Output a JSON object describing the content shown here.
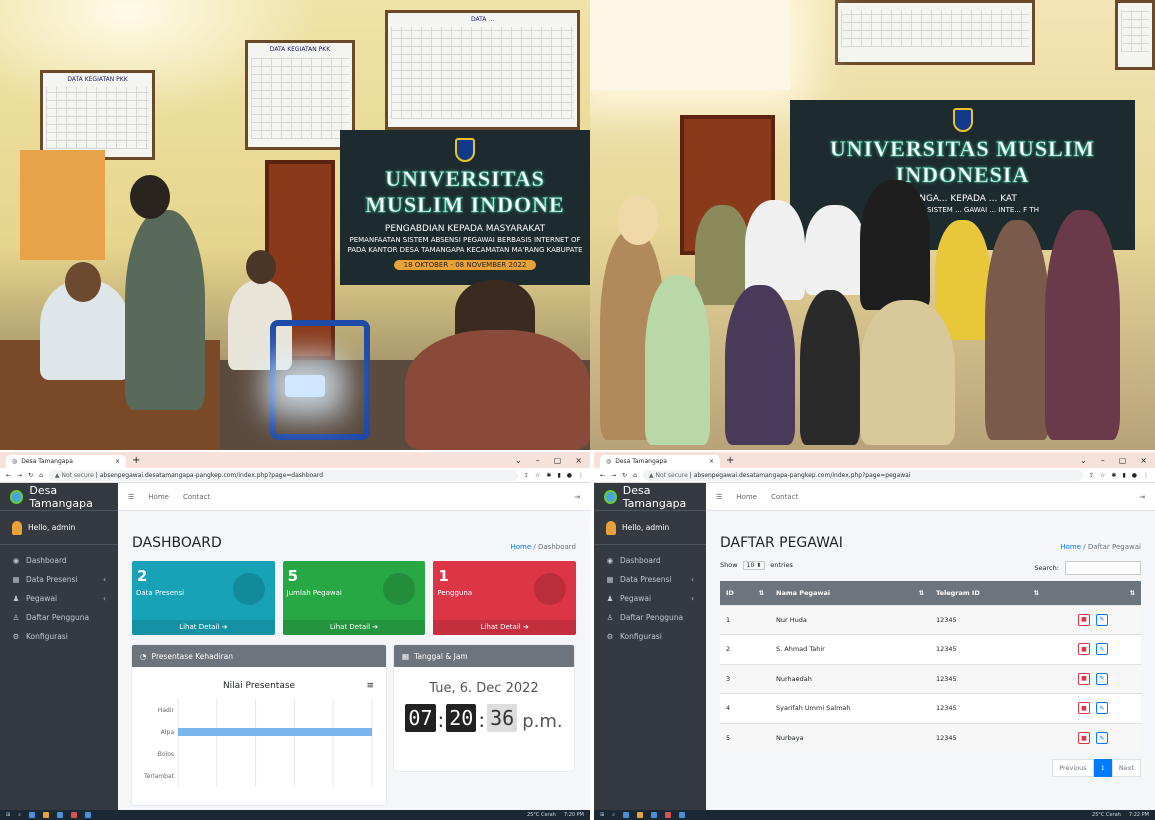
{
  "photos": {
    "left": {
      "banner": {
        "university": "UNIVERSITAS MUSLIM INDONE",
        "line1": "PENGABDIAN KEPADA MASYARAKAT",
        "line2": "PEMANFAATAN SISTEM ABSENSI PEGAWAI BERBASIS INTERNET OF",
        "line3": "PADA KANTOR DESA TAMANGAPA KECAMATAN MA'RANG KABUPATE",
        "date": "18 OKTOBER - 08 NOVEMBER 2022"
      },
      "board1": "DATA KEGIATAN PKK",
      "board2": "DATA KEGIATAN PKK",
      "board3": "DATA ..."
    },
    "right": {
      "banner": {
        "university": "UNIVERSITAS MUSLIM INDONESIA",
        "line1": "PENGA... KEPADA ... KAT",
        "line2": "PEMAN... N SISTEM ... GAWAI ... INTE... F TH"
      }
    }
  },
  "shot1": {
    "tab_title": "Desa Tamangapa",
    "url_security": "Not secure",
    "url": "absenpegawai.desatamangapa-pangkep.com/index.php?page=dashboard",
    "brand": "Desa Tamangapa",
    "user": "Hello, admin",
    "nav": [
      {
        "label": "Dashboard",
        "icon": "tachometer-icon",
        "glyph": "◉"
      },
      {
        "label": "Data Presensi",
        "icon": "calendar-icon",
        "glyph": "▦",
        "chev": "‹"
      },
      {
        "label": "Pegawai",
        "icon": "users-icon",
        "glyph": "♟",
        "chev": "‹"
      },
      {
        "label": "Daftar Pengguna",
        "icon": "user-group-icon",
        "glyph": "♙"
      },
      {
        "label": "Konfigurasi",
        "icon": "cogs-icon",
        "glyph": "⚙"
      }
    ],
    "topnav": {
      "menu": "☰",
      "home": "Home",
      "contact": "Contact",
      "logout": "⇥"
    },
    "page_title": "DASHBOARD",
    "crumb_home": "Home",
    "crumb_sep": "/",
    "crumb_current": "Dashboard",
    "boxes": [
      {
        "value": "2",
        "label": "Data Presensi",
        "link": "Lihat Detail ➔",
        "color": "#17a2b8",
        "icon": "pie-chart-icon"
      },
      {
        "value": "5",
        "label": "Jumlah Pegawai",
        "link": "Lihat Detail ➔",
        "color": "#28a745",
        "icon": "user-icon"
      },
      {
        "value": "1",
        "label": "Pengguna",
        "link": "Lihat Detail ➔",
        "color": "#dc3545",
        "icon": "user-shield-icon"
      }
    ],
    "attendance_card": {
      "title": "Presentase Kehadiran",
      "chart_title": "Nilai Presentase",
      "menu": "≡"
    },
    "clock_card": {
      "title": "Tanggal & Jam",
      "date": "Tue, 6. Dec 2022",
      "hours": "07",
      "minutes": "20",
      "seconds": "36",
      "ampm": "p.m."
    },
    "taskbar": {
      "weather": "25°C Cerah",
      "time": "7:20 PM"
    }
  },
  "chart_data": {
    "type": "bar",
    "orientation": "horizontal",
    "title": "Nilai Presentase",
    "categories": [
      "Hadir",
      "Alpa",
      "Bolos",
      "Terlambat"
    ],
    "values": [
      0,
      100,
      0,
      0
    ],
    "xlim": [
      0,
      100
    ],
    "grid": true,
    "color": "#7cb5ec"
  },
  "shot2": {
    "tab_title": "Desa Tamangapa",
    "url_security": "Not secure",
    "url": "absenpegawai.desatamangapa-pangkep.com/index.php?page=pegawai",
    "brand": "Desa Tamangapa",
    "user": "Hello, admin",
    "nav": [
      {
        "label": "Dashboard",
        "icon": "tachometer-icon",
        "glyph": "◉"
      },
      {
        "label": "Data Presensi",
        "icon": "calendar-icon",
        "glyph": "▦",
        "chev": "‹"
      },
      {
        "label": "Pegawai",
        "icon": "users-icon",
        "glyph": "♟",
        "chev": "‹"
      },
      {
        "label": "Daftar Pengguna",
        "icon": "user-group-icon",
        "glyph": "♙"
      },
      {
        "label": "Konfigurasi",
        "icon": "cogs-icon",
        "glyph": "⚙"
      }
    ],
    "topnav": {
      "menu": "☰",
      "home": "Home",
      "contact": "Contact",
      "logout": "⇥"
    },
    "page_title": "DAFTAR PEGAWAI",
    "crumb_home": "Home",
    "crumb_sep": "/",
    "crumb_current": "Daftar Pegawai",
    "show": "Show",
    "entries_value": "10",
    "entries": "entries",
    "search": "Search:",
    "columns": [
      "ID",
      "Nama Pegawai",
      "Telegram ID",
      ""
    ],
    "rows": [
      {
        "id": "1",
        "name": "Nur Huda",
        "telegram": "12345"
      },
      {
        "id": "2",
        "name": "S. Ahmad Tahir",
        "telegram": "12345"
      },
      {
        "id": "3",
        "name": "Nurhaedah",
        "telegram": "12345"
      },
      {
        "id": "4",
        "name": "Syarifah Ummi Salmah",
        "telegram": "12345"
      },
      {
        "id": "5",
        "name": "Nurbaya",
        "telegram": "12345"
      }
    ],
    "pager": {
      "prev": "Previous",
      "page": "1",
      "next": "Next"
    },
    "taskbar": {
      "weather": "25°C Cerah",
      "time": "7:22 PM"
    }
  }
}
